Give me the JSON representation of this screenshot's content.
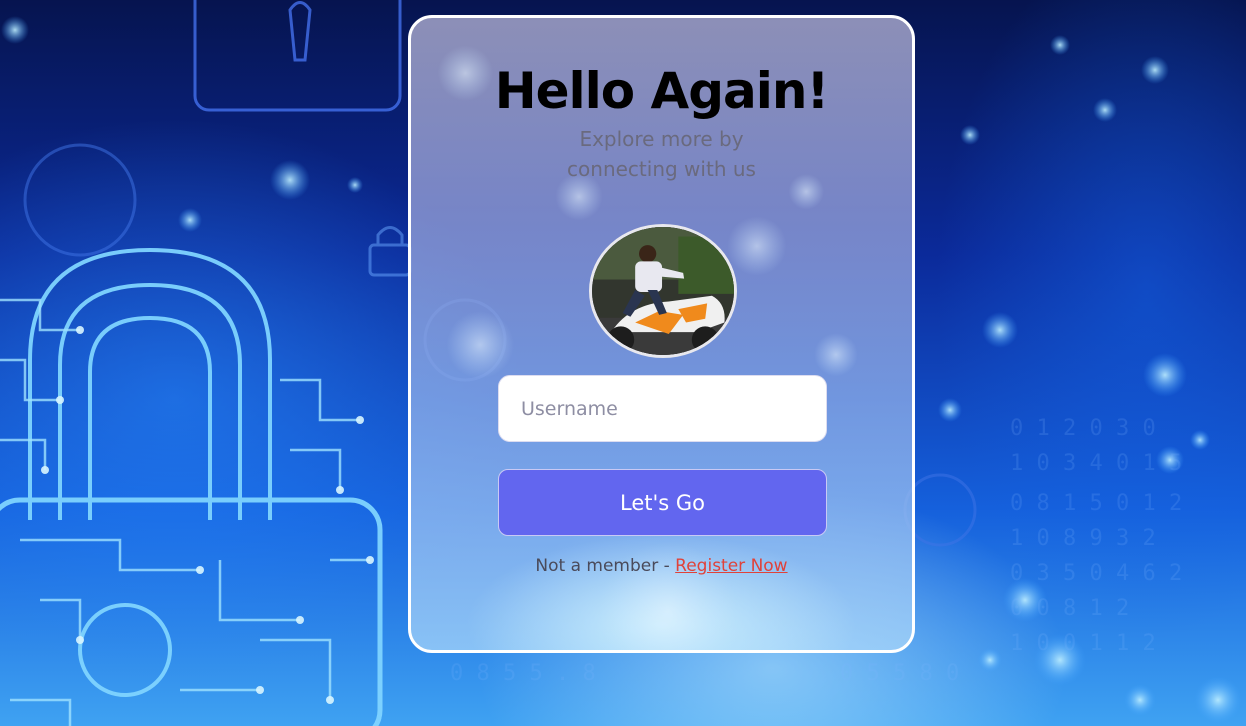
{
  "card": {
    "title": "Hello Again!",
    "subtitle_line1": "Explore more by",
    "subtitle_line2": "connecting with us"
  },
  "form": {
    "username_placeholder": "Username",
    "username_value": "",
    "submit_label": "Let's Go"
  },
  "footer": {
    "prompt": "Not a member - ",
    "register_label": "Register Now"
  },
  "colors": {
    "button": "#6266ef",
    "link": "#e0423a",
    "card_border": "#ffffff",
    "background": "#0b2a9a"
  },
  "icons": {
    "background": "circuit-padlock-image",
    "avatar": "user-profile-photo"
  }
}
